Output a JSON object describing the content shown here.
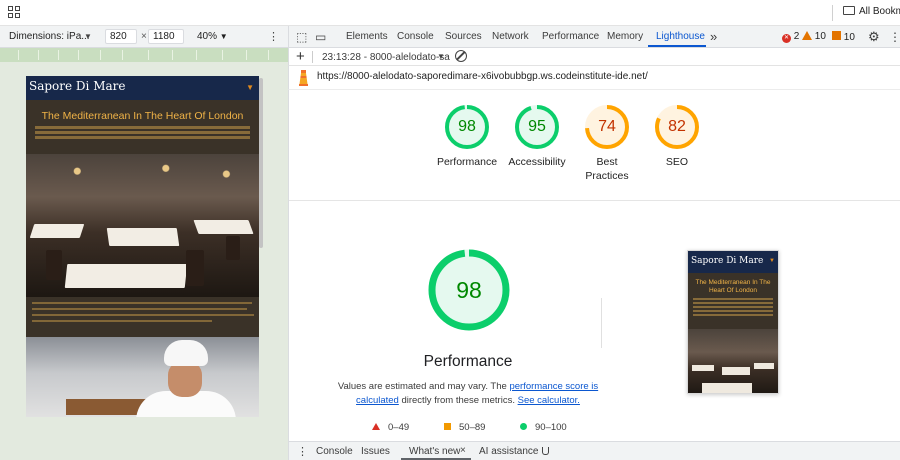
{
  "bookmarks_bar": {
    "all_bookmarks_label": "All Bookm"
  },
  "device_toolbar": {
    "dimensions_label": "Dimensions: iPa...",
    "width_value": "820",
    "height_value": "1180",
    "times_symbol": "×",
    "zoom_label": "40%"
  },
  "site_preview": {
    "brand": "Sapore Di Mare",
    "hero_heading": "The Mediterranean In The Heart Of London"
  },
  "devtools": {
    "tabs": [
      "Elements",
      "Console",
      "Sources",
      "Network",
      "Performance",
      "Memory",
      "Lighthouse"
    ],
    "active_tab": "Lighthouse",
    "more_tabs_symbol": "»",
    "errors_count": "2",
    "warnings_count": "10",
    "issues_count": "10",
    "session_label": "23:13:28 - 8000-alelodato-sa",
    "report_url": "https://8000-alelodato-saporedimare-x6ivobubbgp.ws.codeinstitute-ide.net/"
  },
  "scores": [
    {
      "label": "Performance",
      "score": "98",
      "value": 98
    },
    {
      "label": "Accessibility",
      "score": "95",
      "value": 95
    },
    {
      "label": "Best Practices",
      "score": "74",
      "value": 74
    },
    {
      "label": "SEO",
      "score": "82",
      "value": 82
    }
  ],
  "performance_detail": {
    "score": "98",
    "value": 98,
    "title": "Performance",
    "note_before": "Values are estimated and may vary. The ",
    "link_score": "performance score is calculated",
    "note_middle": " directly from these metrics. ",
    "link_calc": "See calculator.",
    "legend": [
      {
        "range": "0–49"
      },
      {
        "range": "50–89"
      },
      {
        "range": "90–100"
      }
    ]
  },
  "drawer": {
    "tabs": [
      "Console",
      "Issues",
      "What's new",
      "AI assistance"
    ],
    "close_symbol": "×"
  },
  "colors": {
    "pass": "#0cce6b",
    "average": "#ffa400",
    "fail": "#ff4e42",
    "accent": "#0b57d0"
  }
}
